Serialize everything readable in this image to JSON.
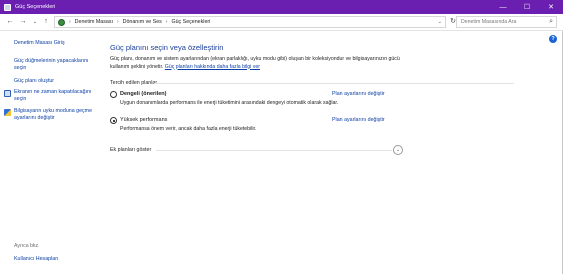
{
  "window": {
    "title": "Güç Seçenekleri",
    "controls": {
      "minimize": "—",
      "maximize": "☐",
      "close": "✕"
    }
  },
  "address": {
    "back": "←",
    "forward": "→",
    "down": "⌄",
    "up": "↑",
    "separator": "›",
    "crumbs": [
      "Denetim Masası",
      "Dönanım ve Ses",
      "Güç Seçenekleri"
    ],
    "dropdown": "⌄",
    "refresh": "↻",
    "search_placeholder": "Denetim Masasında Ara",
    "search_icon": "⌕"
  },
  "sidebar": {
    "items": [
      {
        "label": "Denetim Masası Giriş"
      },
      {
        "label": "Güç düğmelerinin yapacaklarını seçin"
      },
      {
        "label": "Güç planı oluştur"
      },
      {
        "label": "Ekranın ne zaman kapatılacağını seçin",
        "icon": "monitor-icon"
      },
      {
        "label": "Bilgisayarın uyku moduna geçme ayarlarını değiştir",
        "icon": "shield-icon"
      }
    ],
    "see_also": "Ayrıca bkz.",
    "bottom_link": "Kullanıcı Hesapları"
  },
  "main": {
    "help": "?",
    "heading": "Güç planını seçin veya özelleştirin",
    "description": "Güç planı, donanım ve sistem ayarlarından (ekran parlaklığı, uyku modu gibi) oluşan bir koleksiyondur ve bilgisayarınızın gücü kullanım şeklini yönetir.",
    "description_link": "Güç planları hakkında daha fazla bilgi ver",
    "group_label": "Tercih edilen planlar",
    "plans": [
      {
        "name": "Dengeli (önerilen)",
        "description": "Uygun donanımlarda performans ile enerji tüketimini arasındaki dengeyi otomatik olarak sağlar.",
        "link": "Plan ayarlarını değiştir",
        "selected": false
      },
      {
        "name": "Yüksek performans",
        "description": "Performansa önem verir, ancak daha fazla enerji tüketebilir.",
        "link": "Plan ayarlarını değiştir",
        "selected": true
      }
    ],
    "more_plans": "Ek planları göster",
    "chevron": "⌄"
  }
}
